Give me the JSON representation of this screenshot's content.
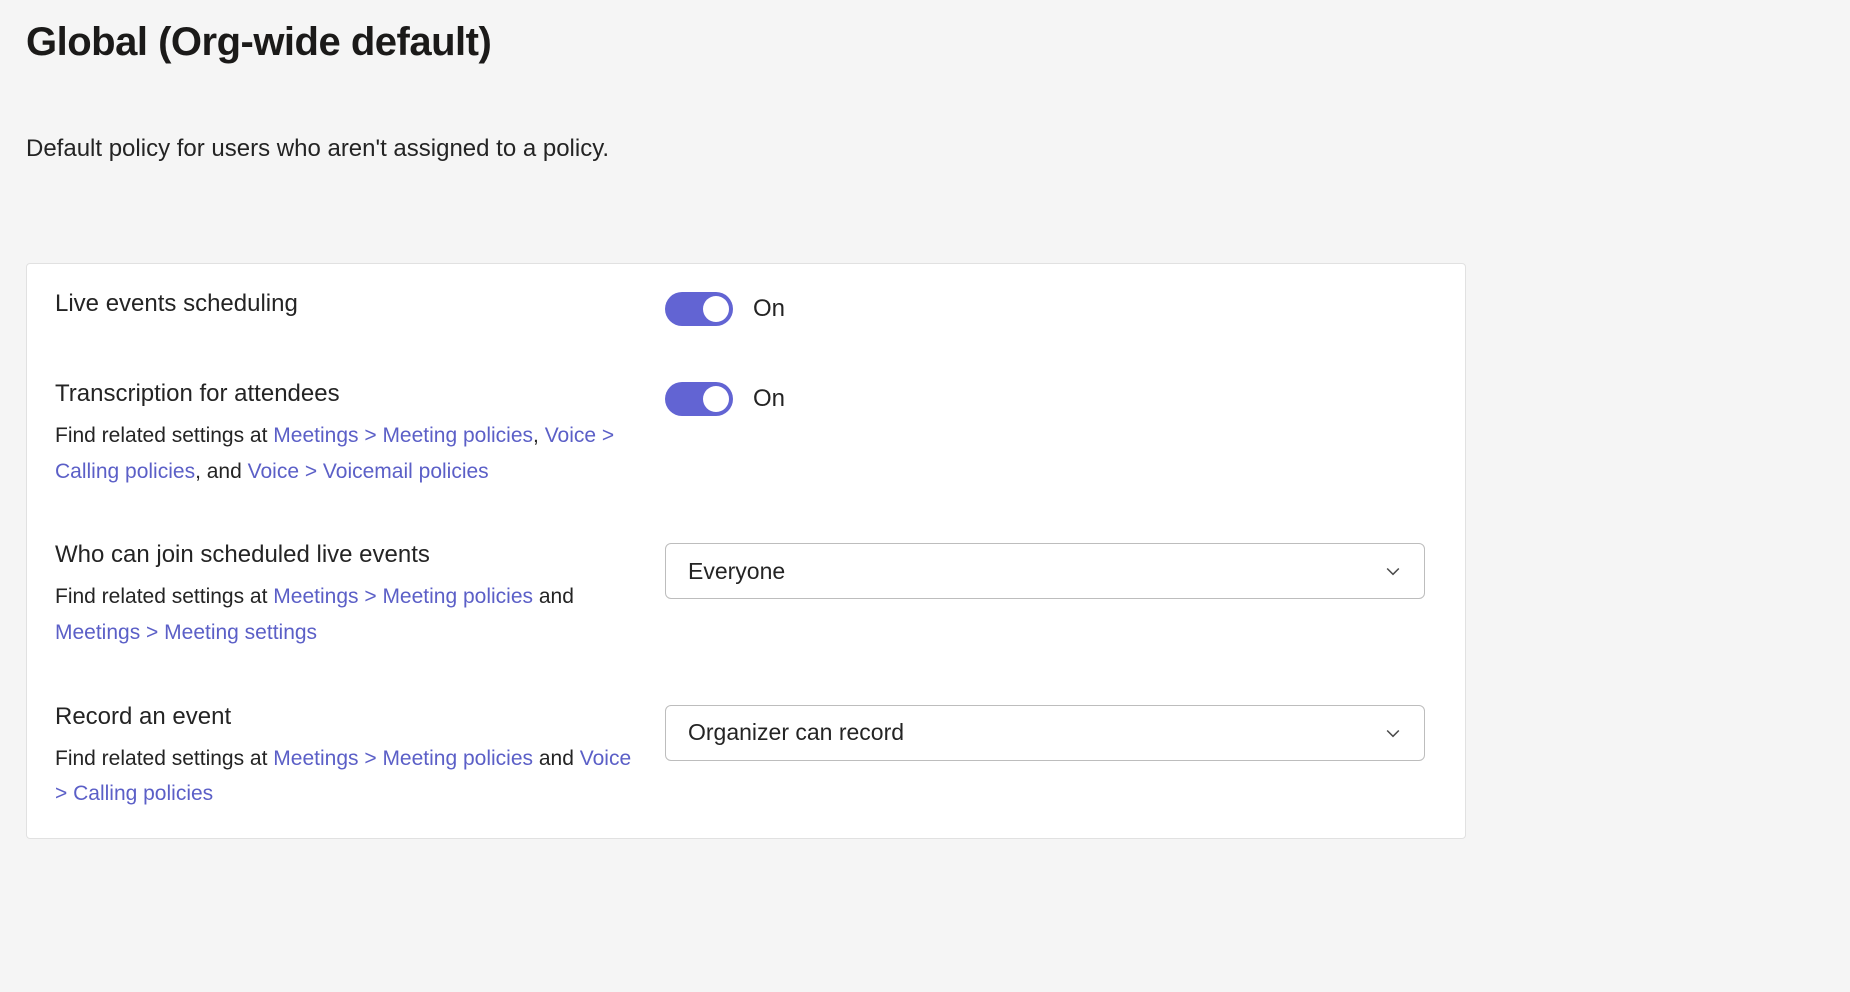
{
  "page": {
    "title": "Global (Org-wide default)",
    "description": "Default policy for users who aren't assigned to a policy."
  },
  "settings": {
    "live_events_scheduling": {
      "title": "Live events scheduling",
      "toggle": {
        "state_label": "On",
        "on": true
      }
    },
    "transcription": {
      "title": "Transcription for attendees",
      "help_prefix": "Find related settings at ",
      "link1": "Meetings > Meeting policies",
      "sep1": ", ",
      "link2": "Voice > Calling policies",
      "sep2": ", and ",
      "link3": "Voice > Voicemail policies",
      "toggle": {
        "state_label": "On",
        "on": true
      }
    },
    "who_can_join": {
      "title": "Who can join scheduled live events",
      "help_prefix": "Find related settings at ",
      "link1": "Meetings > Meeting policies",
      "sep1": " and ",
      "link2": "Meetings > Meeting settings",
      "selected": "Everyone"
    },
    "record_event": {
      "title": "Record an event",
      "help_prefix": "Find related settings at ",
      "link1": "Meetings > Meeting policies",
      "sep1": " and ",
      "link2": "Voice > Calling policies",
      "selected": "Organizer can record"
    }
  }
}
